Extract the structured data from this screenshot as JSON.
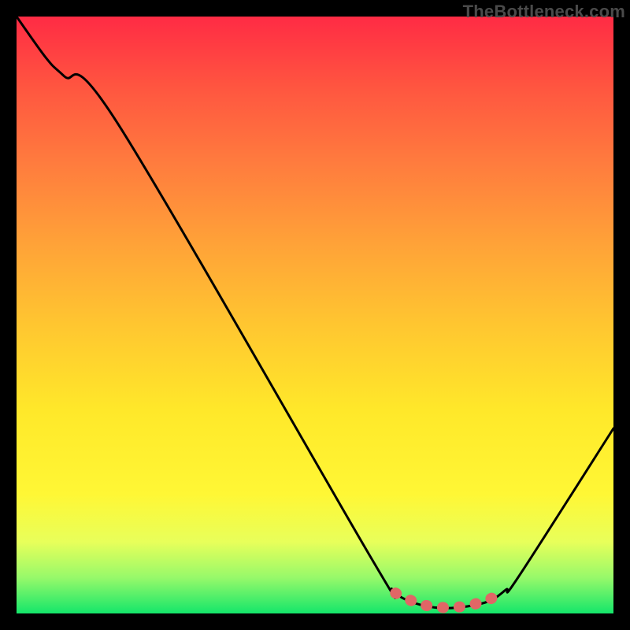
{
  "watermark": "TheBottleneck.com",
  "chart_data": {
    "type": "line",
    "title": "",
    "xlabel": "",
    "ylabel": "",
    "xlim": [
      0,
      100
    ],
    "ylim": [
      0,
      100
    ],
    "series": [
      {
        "name": "curve",
        "color": "#000000",
        "x": [
          0,
          5,
          8,
          17,
          59,
          63,
          66,
          70,
          74,
          79,
          82,
          84,
          100
        ],
        "y": [
          100,
          93,
          90,
          82,
          10,
          4,
          2,
          1,
          1,
          2,
          4,
          6,
          31
        ]
      },
      {
        "name": "highlight",
        "color": "#e26a6a",
        "x": [
          63.5,
          66,
          68,
          70,
          73,
          76,
          79,
          81.5
        ],
        "y": [
          3.4,
          2.2,
          1.5,
          1.1,
          1.0,
          1.4,
          2.3,
          3.5
        ]
      }
    ],
    "gradient_stops": [
      {
        "pct": 0,
        "color": "#ff2b44"
      },
      {
        "pct": 12,
        "color": "#ff5640"
      },
      {
        "pct": 24,
        "color": "#ff7a3e"
      },
      {
        "pct": 38,
        "color": "#ffa238"
      },
      {
        "pct": 52,
        "color": "#ffc730"
      },
      {
        "pct": 66,
        "color": "#ffe82a"
      },
      {
        "pct": 80,
        "color": "#fff735"
      },
      {
        "pct": 88,
        "color": "#e8ff5a"
      },
      {
        "pct": 94,
        "color": "#97f96a"
      },
      {
        "pct": 100,
        "color": "#14e66a"
      }
    ]
  }
}
